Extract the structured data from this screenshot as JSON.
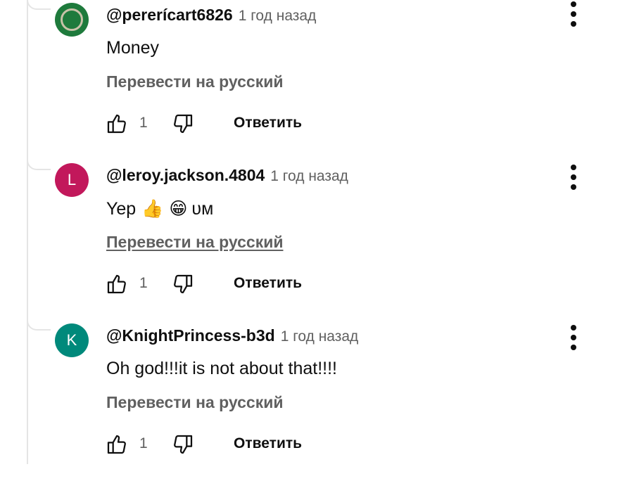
{
  "comments": [
    {
      "author": "@pererícart6826",
      "time": "1 год назад",
      "text": "Money",
      "translate": "Перевести на русский",
      "likes": "1",
      "reply": "Ответить",
      "avatar": {
        "letter": "",
        "color": "#1e7a3c"
      }
    },
    {
      "author": "@leroy.jackson.4804",
      "time": "1 год назад",
      "text": "Yep",
      "emoji": [
        "👍",
        "😁"
      ],
      "text_tail": "ᴜᴍ",
      "translate": "Перевести на русский",
      "likes": "1",
      "reply": "Ответить",
      "avatar": {
        "letter": "L",
        "color": "#c2185b"
      }
    },
    {
      "author": "@KnightPrincess-b3d",
      "time": "1 год назад",
      "text": "Oh god!!!it is not about that!!!!",
      "translate": "Перевести на русский",
      "likes": "1",
      "reply": "Ответить",
      "avatar": {
        "letter": "K",
        "color": "#00897b"
      }
    }
  ]
}
